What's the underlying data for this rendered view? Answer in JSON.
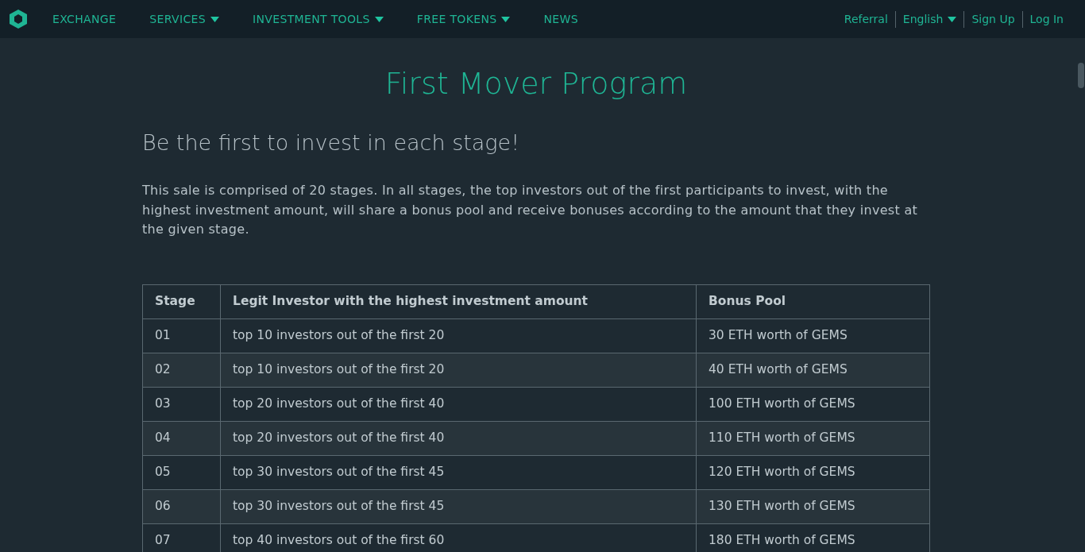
{
  "nav": {
    "items": [
      {
        "label": "EXCHANGE",
        "dropdown": false
      },
      {
        "label": "SERVICES",
        "dropdown": true
      },
      {
        "label": "INVESTMENT TOOLS",
        "dropdown": true
      },
      {
        "label": "FREE TOKENS",
        "dropdown": true
      },
      {
        "label": "NEWS",
        "dropdown": false
      }
    ],
    "right": [
      {
        "label": "Referral",
        "dropdown": false
      },
      {
        "label": "English",
        "dropdown": true
      },
      {
        "label": "Sign Up",
        "dropdown": false
      },
      {
        "label": "Log In",
        "dropdown": false
      }
    ]
  },
  "title": "First Mover Program",
  "subtitle": "Be the first to invest in each stage!",
  "intro": "This sale is comprised of 20 stages. In all stages, the top investors out of the first participants to invest, with the highest investment amount, will share a bonus pool and receive bonuses according to the amount that they invest at the given stage.",
  "table": {
    "columns": [
      "Stage",
      "Legit Investor with the highest investment amount",
      "Bonus Pool"
    ],
    "rows": [
      [
        "01",
        "top 10 investors out of the first 20",
        "30 ETH worth of GEMS"
      ],
      [
        "02",
        "top 10 investors out of the first 20",
        "40 ETH worth of GEMS"
      ],
      [
        "03",
        "top 20 investors out of the first 40",
        "100 ETH worth of GEMS"
      ],
      [
        "04",
        "top 20 investors out of the first 40",
        "110 ETH worth of GEMS"
      ],
      [
        "05",
        "top 30 investors out of the first 45",
        "120 ETH worth of GEMS"
      ],
      [
        "06",
        "top 30 investors out of the first 45",
        "130 ETH worth of GEMS"
      ],
      [
        "07",
        "top 40 investors out of the first 60",
        "180 ETH worth of GEMS"
      ]
    ]
  }
}
